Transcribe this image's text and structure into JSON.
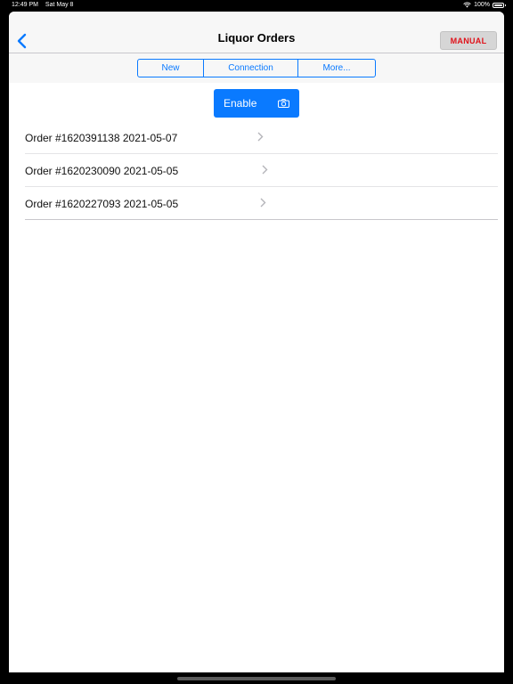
{
  "status_bar": {
    "time": "12:49 PM",
    "date": "Sat May 8",
    "battery": "100%"
  },
  "nav": {
    "title": "Liquor Orders",
    "manual_label": "MANUAL"
  },
  "segments": [
    {
      "label": "New"
    },
    {
      "label": "Connection"
    },
    {
      "label": "More..."
    }
  ],
  "enable": {
    "label": "Enable",
    "icon": "camera-icon"
  },
  "orders": [
    {
      "label": "Order #1620391138 2021-05-07"
    },
    {
      "label": "Order #1620230090 2021-05-05"
    },
    {
      "label": "Order #1620227093 2021-05-05"
    }
  ],
  "colors": {
    "accent": "#0a7aff",
    "manual_text": "#e0121a",
    "nav_background": "#f7f7f7"
  }
}
